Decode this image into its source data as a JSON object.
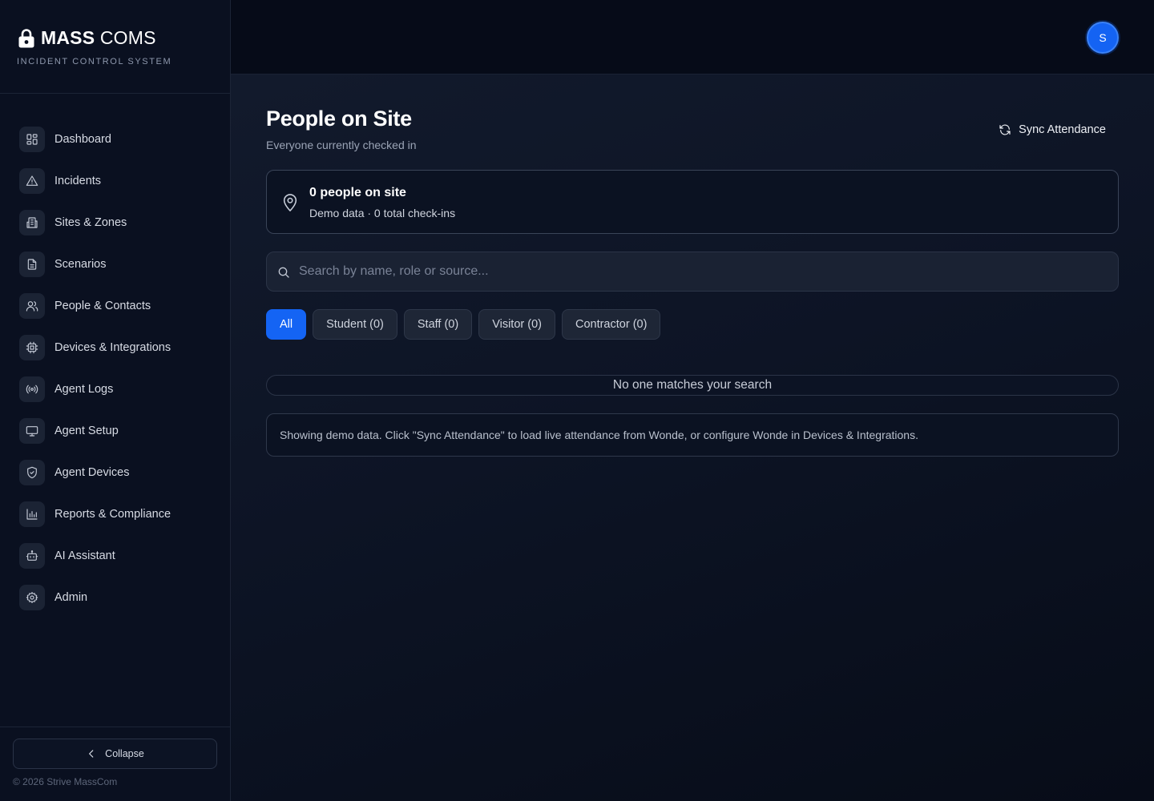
{
  "brand": {
    "title_bold": "MASS",
    "title_light": " COMS",
    "subtitle": "INCIDENT CONTROL SYSTEM",
    "icon": "lock-icon"
  },
  "sidebar": {
    "items": [
      {
        "label": "Dashboard",
        "icon": "dashboard-icon"
      },
      {
        "label": "Incidents",
        "icon": "warning-triangle-icon"
      },
      {
        "label": "Sites & Zones",
        "icon": "building-icon"
      },
      {
        "label": "Scenarios",
        "icon": "document-icon"
      },
      {
        "label": "People & Contacts",
        "icon": "users-icon"
      },
      {
        "label": "Devices & Integrations",
        "icon": "chip-icon"
      },
      {
        "label": "Agent Logs",
        "icon": "broadcast-icon"
      },
      {
        "label": "Agent Setup",
        "icon": "monitor-icon"
      },
      {
        "label": "Agent Devices",
        "icon": "shield-icon"
      },
      {
        "label": "Reports & Compliance",
        "icon": "bar-chart-icon"
      },
      {
        "label": "AI Assistant",
        "icon": "robot-icon"
      },
      {
        "label": "Admin",
        "icon": "gear-icon"
      }
    ],
    "collapse_label": "Collapse",
    "copyright": "© 2026 Strive MassCom"
  },
  "topbar": {
    "avatar_initial": "S",
    "avatar_color": "#1463f3"
  },
  "main": {
    "title": "People on Site",
    "subtitle": "Everyone currently checked in",
    "sync_label": "Sync Attendance",
    "summary": {
      "count_text": "0 people on site",
      "meta_text": "Demo data · 0 total check-ins"
    },
    "search": {
      "placeholder": "Search by name, role or source...",
      "value": ""
    },
    "filters": [
      {
        "label": "All",
        "active": true
      },
      {
        "label": "Student (0)",
        "active": false
      },
      {
        "label": "Staff (0)",
        "active": false
      },
      {
        "label": "Visitor (0)",
        "active": false
      },
      {
        "label": "Contractor (0)",
        "active": false
      }
    ],
    "empty_message": "No one matches your search",
    "notice": "Showing demo data. Click \"Sync Attendance\" to load live attendance from Wonde, or configure Wonde in Devices & Integrations."
  },
  "colors": {
    "accent": "#1464f4",
    "background": "#080d1c",
    "sidebar": "#0a1020"
  }
}
